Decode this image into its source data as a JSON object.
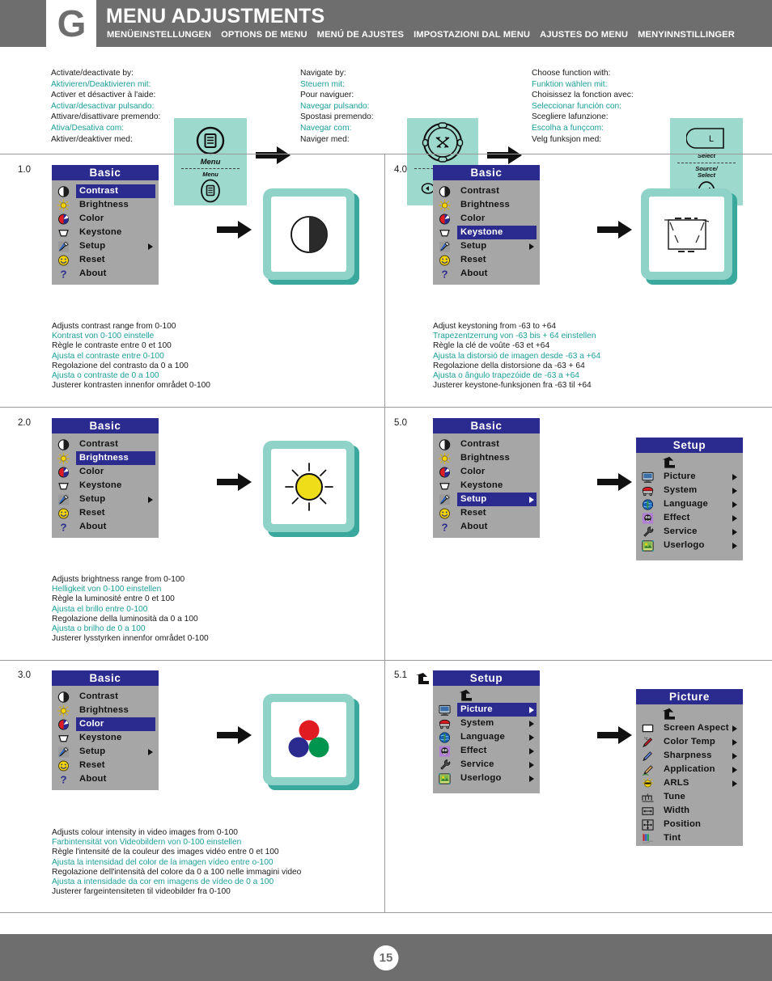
{
  "header": {
    "letter": "G",
    "title": "MENU ADJUSTMENTS",
    "subtitles": [
      "MENÜEINSTELLUNGEN",
      "OPTIONS DE MENU",
      "MENÚ DE AJUSTES",
      "IMPOSTAZIONI DAL MENU",
      "AJUSTES DO MENU",
      "MENYINNSTILLINGER"
    ]
  },
  "instructions": [
    {
      "id": "activate",
      "lines": [
        "Activate/deactivate by:",
        "Aktivieren/Deaktivieren mit:",
        "Activer et désactiver à l'aide:",
        "Activar/desactivar pulsando:",
        "Attivare/disattivare premendo:",
        "Ativa/Desativa com:",
        "Aktiver/deaktiver med:"
      ],
      "key_top_caption": "Menu",
      "key_bottom_caption": "Menu"
    },
    {
      "id": "navigate",
      "lines": [
        "Navigate by:",
        "Steuern mit:",
        "Pour naviguer:",
        "Navegar pulsando:",
        "Spostasi premendo:",
        "Navegar com:",
        "Naviger med:"
      ],
      "key_top_caption": "",
      "key_bottom_caption": ""
    },
    {
      "id": "choose",
      "lines": [
        "Choose function with:",
        "Funktion wählen mit:",
        "Choisissez la fonction avec:",
        "Seleccionar función con:",
        "Scegliere lafunzione:",
        "Escolha a funçcom:",
        "Velg funksjon med:"
      ],
      "key_top_caption": "Select",
      "key_bottom_caption": "Source/ Select",
      "key_letter": "L"
    }
  ],
  "basic_menu": {
    "title": "Basic",
    "items": [
      {
        "label": "Contrast",
        "icon": "contrast-icon",
        "submenu": false
      },
      {
        "label": "Brightness",
        "icon": "brightness-icon",
        "submenu": false
      },
      {
        "label": "Color",
        "icon": "color-icon",
        "submenu": false
      },
      {
        "label": "Keystone",
        "icon": "keystone-icon",
        "submenu": false
      },
      {
        "label": "Setup",
        "icon": "setup-icon",
        "submenu": true
      },
      {
        "label": "Reset",
        "icon": "reset-icon",
        "submenu": false
      },
      {
        "label": "About",
        "icon": "about-icon",
        "submenu": false
      }
    ]
  },
  "setup_menu": {
    "title": "Setup",
    "items": [
      {
        "label": "Picture",
        "icon": "picture-icon",
        "submenu": true
      },
      {
        "label": "System",
        "icon": "system-icon",
        "submenu": true
      },
      {
        "label": "Language",
        "icon": "language-icon",
        "submenu": true
      },
      {
        "label": "Effect",
        "icon": "effect-icon",
        "submenu": true
      },
      {
        "label": "Service",
        "icon": "service-icon",
        "submenu": true
      },
      {
        "label": "Userlogo",
        "icon": "userlogo-icon",
        "submenu": true
      }
    ]
  },
  "picture_menu": {
    "title": "Picture",
    "items": [
      {
        "label": "Screen Aspect",
        "icon": "screen-aspect-icon",
        "submenu": true
      },
      {
        "label": "Color Temp",
        "icon": "color-temp-icon",
        "submenu": true
      },
      {
        "label": "Sharpness",
        "icon": "sharpness-icon",
        "submenu": true
      },
      {
        "label": "Application",
        "icon": "application-icon",
        "submenu": true
      },
      {
        "label": "ARLS",
        "icon": "arls-icon",
        "submenu": true
      },
      {
        "label": "Tune",
        "icon": "tune-icon",
        "submenu": false
      },
      {
        "label": "Width",
        "icon": "width-icon",
        "submenu": false
      },
      {
        "label": "Position",
        "icon": "position-icon",
        "submenu": false
      },
      {
        "label": "Tint",
        "icon": "tint-icon",
        "submenu": false
      }
    ]
  },
  "steps": [
    {
      "number": "1.0",
      "selected": "Contrast",
      "preview": "contrast-preview",
      "desc": [
        "Adjusts contrast range from 0-100",
        "Kontrast von 0-100 einstelle",
        "Règle le contraste entre 0 et 100",
        "Ajusta el contraste entre 0-100",
        "Regolazione del contrasto da 0 a 100",
        "Ajusta o contraste de 0 a 100",
        "Justerer kontrasten innenfor området 0-100"
      ]
    },
    {
      "number": "2.0",
      "selected": "Brightness",
      "preview": "brightness-preview",
      "desc": [
        "Adjusts brightness range from 0-100",
        "Helligkeit von 0-100 einstellen",
        "Règle la luminosité entre 0 et 100",
        "Ajusta el brillo entre 0-100",
        "Regolazione della luminosità da 0 a 100",
        "Ajusta o brilho de 0 a 100",
        "Justerer lysstyrken innenfor området 0-100"
      ]
    },
    {
      "number": "3.0",
      "selected": "Color",
      "preview": "color-preview",
      "desc": [
        "Adjusts colour intensity in video images from 0-100",
        "Farbintensität von Videobildern von 0-100 einstellen",
        "Règle l'intensité de la couleur des images vidéo entre 0 et 100",
        "Ajusta la intensidad del color de la imagen vídeo entre o-100",
        "Regolazione dell'intensità del colore da 0 a 100 nelle immagini video",
        "Ajusta a intensidade da cor em imagens de vídeo de 0 a 100",
        "Justerer fargeintensiteten til videobilder fra 0-100"
      ]
    },
    {
      "number": "4.0",
      "selected": "Keystone",
      "preview": "keystone-preview",
      "desc": [
        "Adjust keystoning from -63 to +64",
        "Trapezentzerrung von -63 bis + 64 einstellen",
        "Règle la clé de voûte -63 et +64",
        "Ajusta la distorsió de imagen desde -63 a +64",
        "Regolazione della distorsione da -63 + 64",
        "Ajusta o ângulo trapezóide de -63 a +64",
        "Justerer keystone-funksjonen fra -63 til +64"
      ]
    },
    {
      "number": "5.0",
      "selected": "Setup",
      "preview": "setup-submenu",
      "desc": []
    },
    {
      "number": "5.1",
      "selected": "Picture",
      "preview": "picture-submenu",
      "desc": []
    }
  ],
  "footer": {
    "page": "15"
  },
  "colors": {
    "header_bg": "#6e6e6e",
    "accent_teal": "#1a9e99",
    "key_card": "#9ed9ce",
    "osd_body": "#a6a6a6",
    "osd_title": "#2b2b8f",
    "preview_frame": "#8fd3c8",
    "preview_shadow": "#3aa89c"
  }
}
